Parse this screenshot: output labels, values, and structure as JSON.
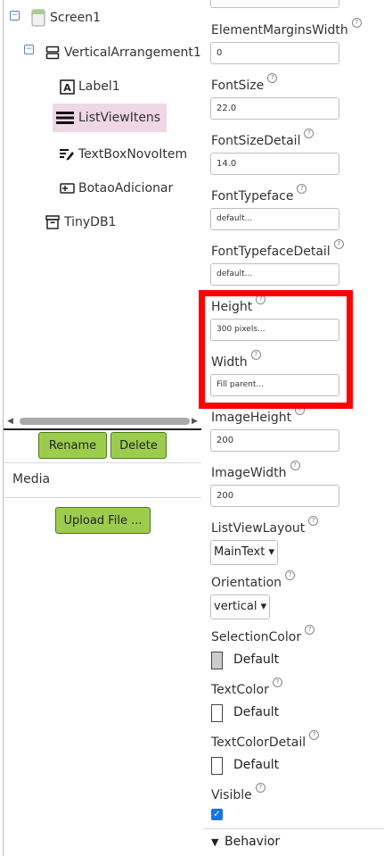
{
  "tree": {
    "items": [
      {
        "label": "Screen1",
        "icon": "screen-icon",
        "toggle": "⊟"
      },
      {
        "label": "VerticalArrangement1",
        "icon": "vertical-arrangement-icon",
        "toggle": "⊟"
      },
      {
        "label": "Label1",
        "icon": "label-icon"
      },
      {
        "label": "ListViewItens",
        "icon": "listview-icon",
        "selected": true
      },
      {
        "label": "TextBoxNovoItem",
        "icon": "textbox-icon"
      },
      {
        "label": "BotaoAdicionar",
        "icon": "button-icon"
      },
      {
        "label": "TinyDB1",
        "icon": "tinydb-icon"
      }
    ]
  },
  "actions": {
    "rename": "Rename",
    "delete": "Delete"
  },
  "media": {
    "label": "Media",
    "upload": "Upload File ..."
  },
  "properties": {
    "help_glyph": "?",
    "element_margins_width": {
      "label": "ElementMarginsWidth",
      "value": "0"
    },
    "font_size": {
      "label": "FontSize",
      "value": "22.0"
    },
    "font_size_detail": {
      "label": "FontSizeDetail",
      "value": "14.0"
    },
    "font_typeface": {
      "label": "FontTypeface",
      "value": "default..."
    },
    "font_typeface_detail": {
      "label": "FontTypefaceDetail",
      "value": "default..."
    },
    "height": {
      "label": "Height",
      "value": "300 pixels..."
    },
    "width": {
      "label": "Width",
      "value": "Fill parent..."
    },
    "image_height": {
      "label": "ImageHeight",
      "value": "200"
    },
    "image_width": {
      "label": "ImageWidth",
      "value": "200"
    },
    "list_view_layout": {
      "label": "ListViewLayout",
      "value": "MainText"
    },
    "orientation": {
      "label": "Orientation",
      "value": "vertical"
    },
    "selection_color": {
      "label": "SelectionColor",
      "value": "Default",
      "swatch": "#cccccc"
    },
    "text_color": {
      "label": "TextColor",
      "value": "Default",
      "swatch": "#ffffff"
    },
    "text_color_detail": {
      "label": "TextColorDetail",
      "value": "Default",
      "swatch": "#ffffff"
    },
    "visible": {
      "label": "Visible",
      "checked": true
    }
  },
  "behavior": {
    "label": "Behavior"
  },
  "colors": {
    "accent_green": "#9ccc4b",
    "highlight": "#ff0000",
    "selection_bg": "#efd7e6",
    "checkbox": "#1a73e8"
  }
}
